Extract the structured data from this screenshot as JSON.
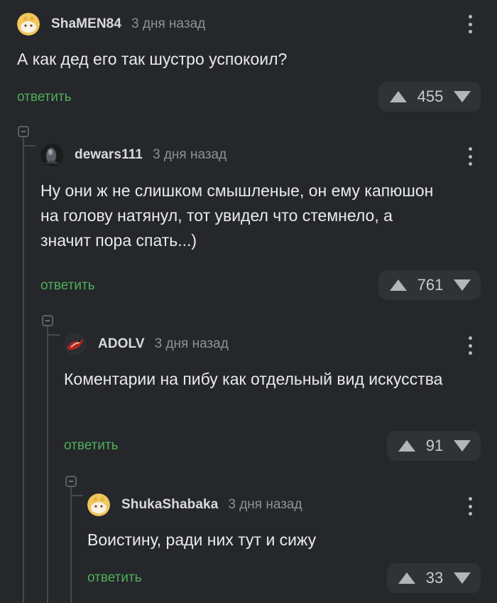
{
  "comments": [
    {
      "username": "ShaMEN84",
      "time": "3 дня назад",
      "text": "А как дед его так шустро успокоил?",
      "reply_label": "ответить",
      "score": "455",
      "avatar_icon": "default-avatar-icon"
    },
    {
      "username": "dewars111",
      "time": "3 дня назад",
      "text": "Ну они ж не слишком смышленые, он ему капюшон на голову натянул, тот увидел что стемнело, а значит пора спать...)",
      "reply_label": "ответить",
      "score": "761",
      "avatar_icon": "dark-photo-avatar-icon"
    },
    {
      "username": "ADOLV",
      "time": "3 дня назад",
      "text": "Коментарии на пибу как отдельный вид искусства",
      "reply_label": "ответить",
      "score": "91",
      "avatar_icon": "red-bird-avatar-icon"
    },
    {
      "username": "ShukaShabaka",
      "time": "3 дня назад",
      "text": "Воистину, ради них тут и сижу",
      "reply_label": "ответить",
      "score": "33",
      "avatar_icon": "default-avatar-icon"
    }
  ],
  "colors": {
    "background": "#25272b",
    "reply_green": "#4fae5a",
    "rating_bg": "#303236",
    "thread_line": "#454850"
  }
}
